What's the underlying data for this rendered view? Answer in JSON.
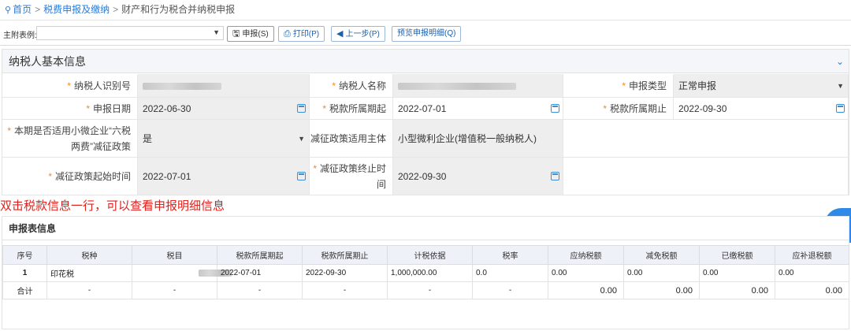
{
  "breadcrumb": {
    "home": "首页",
    "level1": "税费申报及缴纳",
    "level2": "财产和行为税合并纳税申报",
    "separator": ">"
  },
  "toolbar": {
    "label": "主附表例:",
    "select_value": "",
    "save_label": "申报(S)",
    "print_label": "打印(P)",
    "prev_label": "上一步(P)",
    "preview_label": "预览申报明细(Q)"
  },
  "basic_info": {
    "title": "纳税人基本信息",
    "taxpayer_id_label": "纳税人识别号",
    "taxpayer_name_label": "纳税人名称",
    "declare_type_label": "申报类型",
    "declare_type_value": "正常申报",
    "declare_date_label": "申报日期",
    "declare_date_value": "2022-06-30",
    "period_start_label": "税款所属期起",
    "period_start_value": "2022-07-01",
    "period_end_label": "税款所属期止",
    "period_end_value": "2022-09-30",
    "small_micro_label_1": "本期是否适用小微企业“六税",
    "small_micro_label_2": "两费”减征政策",
    "small_micro_value": "是",
    "reduction_subject_label": "减征政策适用主体",
    "reduction_subject_value": "小型微利企业(增值税一般纳税人)",
    "reduction_start_label": "减征政策起始时间",
    "reduction_start_value": "2022-07-01",
    "reduction_end_label_1": "减征政策终止时",
    "reduction_end_label_2": "间",
    "reduction_end_value": "2022-09-30",
    "required_mark": "*"
  },
  "notice": "双击税款信息一行，可以查看申报明细信息",
  "declaration": {
    "title": "申报表信息",
    "columns": [
      "序号",
      "税种",
      "税目",
      "税款所属期起",
      "税款所属期止",
      "计税依据",
      "税率",
      "应纳税额",
      "减免税额",
      "已缴税额",
      "应补退税额"
    ],
    "rows": [
      [
        "1",
        "印花税",
        "",
        "2022-07-01",
        "2022-09-30",
        "1,000,000.00",
        "0.0",
        "0.00",
        "0.00",
        "0.00",
        "0.00"
      ]
    ],
    "total": [
      "合计",
      "-",
      "-",
      "-",
      "-",
      "-",
      "-",
      "0.00",
      "0.00",
      "0.00",
      "0.00"
    ]
  },
  "colors": {
    "link": "#2b7bd6",
    "required": "#f08a2a",
    "notice": "#e0221e",
    "header_bg": "#eef2f8"
  }
}
